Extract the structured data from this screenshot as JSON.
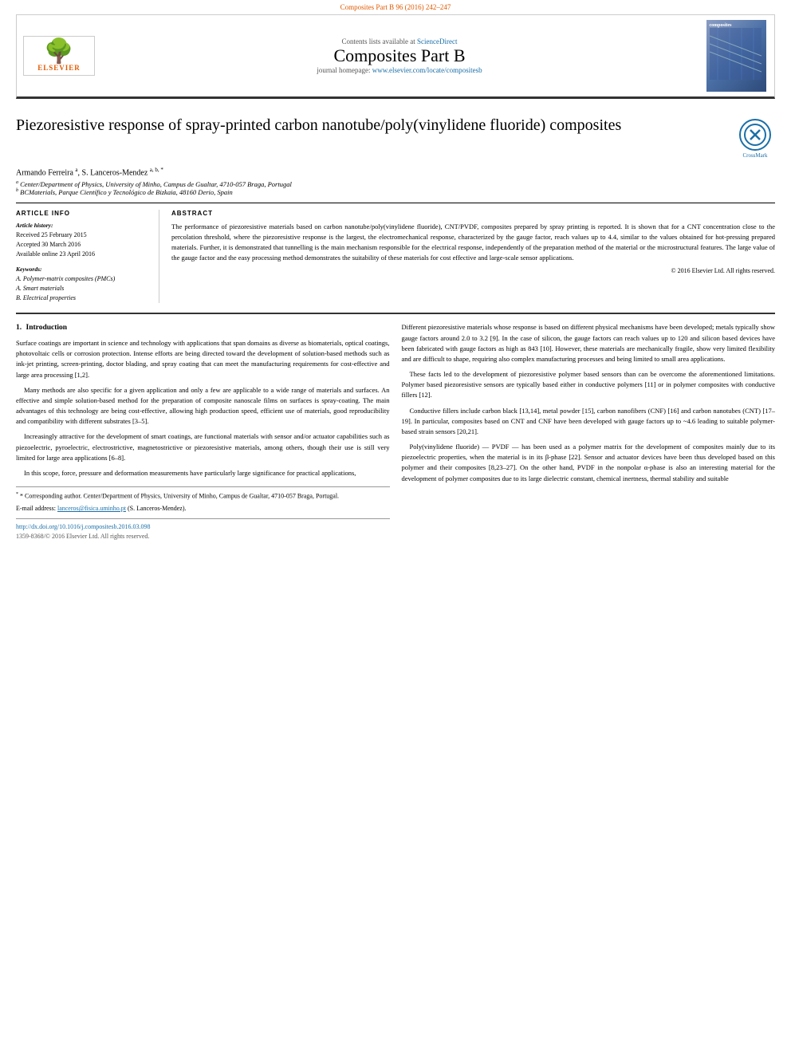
{
  "top_bar": {
    "text": "Composites Part B 96 (2016) 242–247"
  },
  "journal_header": {
    "contents_label": "Contents lists available at",
    "science_direct": "ScienceDirect",
    "journal_name": "Composites Part B",
    "homepage_label": "journal homepage:",
    "homepage_url": "www.elsevier.com/locate/compositesb",
    "elsevier_label": "ELSEVIER"
  },
  "article": {
    "title": "Piezoresistive response of spray-printed carbon nanotube/poly(vinylidene fluoride) composites",
    "crossmark_label": "CrossMark",
    "authors": "Armando Ferreira",
    "authors_full": "Armando Ferreira ᵃ, S. Lanceros-Mendez ᵃ• ᵇ• *",
    "affiliations": [
      {
        "sup": "a",
        "text": "Center/Department of Physics, University of Minho, Campus de Gualtar, 4710-057 Braga, Portugal"
      },
      {
        "sup": "b",
        "text": "BCMaterials, Parque Científico y Tecnológico de Bizkaia, 48160 Derio, Spain"
      }
    ],
    "article_info": {
      "section_title": "ARTICLE INFO",
      "history_label": "Article history:",
      "received": "Received 25 February 2015",
      "accepted": "Accepted 30 March 2016",
      "available": "Available online 23 April 2016",
      "keywords_label": "Keywords:",
      "keywords": [
        "A. Polymer-matrix composites (PMCs)",
        "A. Smart materials",
        "B. Electrical properties"
      ]
    },
    "abstract": {
      "section_title": "ABSTRACT",
      "text": "The performance of piezoresistive materials based on carbon nanotube/poly(vinylidene fluoride), CNT/PVDF, composites prepared by spray printing is reported. It is shown that for a CNT concentration close to the percolation threshold, where the piezoresistive response is the largest, the electromechanical response, characterized by the gauge factor, reach values up to 4.4, similar to the values obtained for hot-pressing prepared materials. Further, it is demonstrated that tunnelling is the main mechanism responsible for the electrical response, independently of the preparation method of the material or the microstructural features. The large value of the gauge factor and the easy processing method demonstrates the suitability of these materials for cost effective and large-scale sensor applications.",
      "copyright": "© 2016 Elsevier Ltd. All rights reserved."
    }
  },
  "body": {
    "section1": {
      "number": "1.",
      "title": "Introduction",
      "paragraphs": [
        "Surface coatings are important in science and technology with applications that span domains as diverse as biomaterials, optical coatings, photovoltaic cells or corrosion protection. Intense efforts are being directed toward the development of solution-based methods such as ink-jet printing, screen-printing, doctor blading, and spray coating that can meet the manufacturing requirements for cost-effective and large area processing [1,2].",
        "Many methods are also specific for a given application and only a few are applicable to a wide range of materials and surfaces. An effective and simple solution-based method for the preparation of composite nanoscale films on surfaces is spray-coating. The main advantages of this technology are being cost-effective, allowing high production speed, efficient use of materials, good reproducibility and compatibility with different substrates [3–5].",
        "Increasingly attractive for the development of smart coatings, are functional materials with sensor and/or actuator capabilities such as piezoelectric, pyroelectric, electrostrictive, magnetostrictive or piezoresistive materials, among others, though their use is still very limited for large area applications [6–8].",
        "In this scope, force, pressure and deformation measurements have particularly large significance for practical applications,"
      ]
    },
    "section1_right": {
      "paragraphs": [
        "Different piezoresistive materials whose response is based on different physical mechanisms have been developed; metals typically show gauge factors around 2.0 to 3.2 [9]. In the case of silicon, the gauge factors can reach values up to 120 and silicon based devices have been fabricated with gauge factors as high as 843 [10]. However, these materials are mechanically fragile, show very limited flexibility and are difficult to shape, requiring also complex manufacturing processes and being limited to small area applications.",
        "These facts led to the development of piezoresistive polymer based sensors than can be overcome the aforementioned limitations. Polymer based piezoresistive sensors are typically based either in conductive polymers [11] or in polymer composites with conductive fillers [12].",
        "Conductive fillers include carbon black [13,14], metal powder [15], carbon nanofibers (CNF) [16] and carbon nanotubes (CNT) [17–19]. In particular, composites based on CNT and CNF have been developed with gauge factors up to ~4.6 leading to suitable polymer-based strain sensors [20,21].",
        "Poly(vinylidene fluoride) — PVDF — has been used as a polymer matrix for the development of composites mainly due to its piezoelectric properties, when the material is in its β-phase [22]. Sensor and actuator devices have been thus developed based on this polymer and their composites [8,23–27]. On the other hand, PVDF in the nonpolar α-phase is also an interesting material for the development of polymer composites due to its large dielectric constant, chemical inertness, thermal stability and suitable"
      ]
    },
    "footnotes": {
      "corresponding": "* Corresponding author. Center/Department of Physics, University of Minho, Campus de Gualtar, 4710-057 Braga, Portugal.",
      "email_label": "E-mail address:",
      "email": "lanceros@fisica.uminho.pt",
      "email_name": "(S. Lanceros-Mendez)."
    },
    "doi": "http://dx.doi.org/10.1016/j.compositesb.2016.03.098",
    "issn": "1359-8368/© 2016 Elsevier Ltd. All rights reserved."
  }
}
